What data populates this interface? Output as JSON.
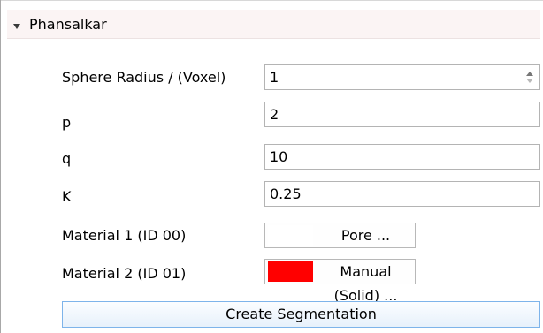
{
  "section": {
    "title": "Phansalkar",
    "expanded": true,
    "icon": "collapse-arrow-down"
  },
  "params": [
    {
      "label": "Sphere Radius / (Voxel)",
      "value": "1",
      "type": "spinbox"
    },
    {
      "label": "p",
      "value": "2",
      "type": "text"
    },
    {
      "label": "q",
      "value": "10",
      "type": "text"
    },
    {
      "label": "K",
      "value": "0.25",
      "type": "text"
    }
  ],
  "materials": [
    {
      "label": "Material 1 (ID 00)",
      "button": "Pore ...",
      "color": "#ffffff"
    },
    {
      "label": "Material 2 (ID 01)",
      "button": "Manual (Solid) ...",
      "color": "#ff0000"
    }
  ],
  "actions": {
    "create_label": "Create Segmentation"
  }
}
